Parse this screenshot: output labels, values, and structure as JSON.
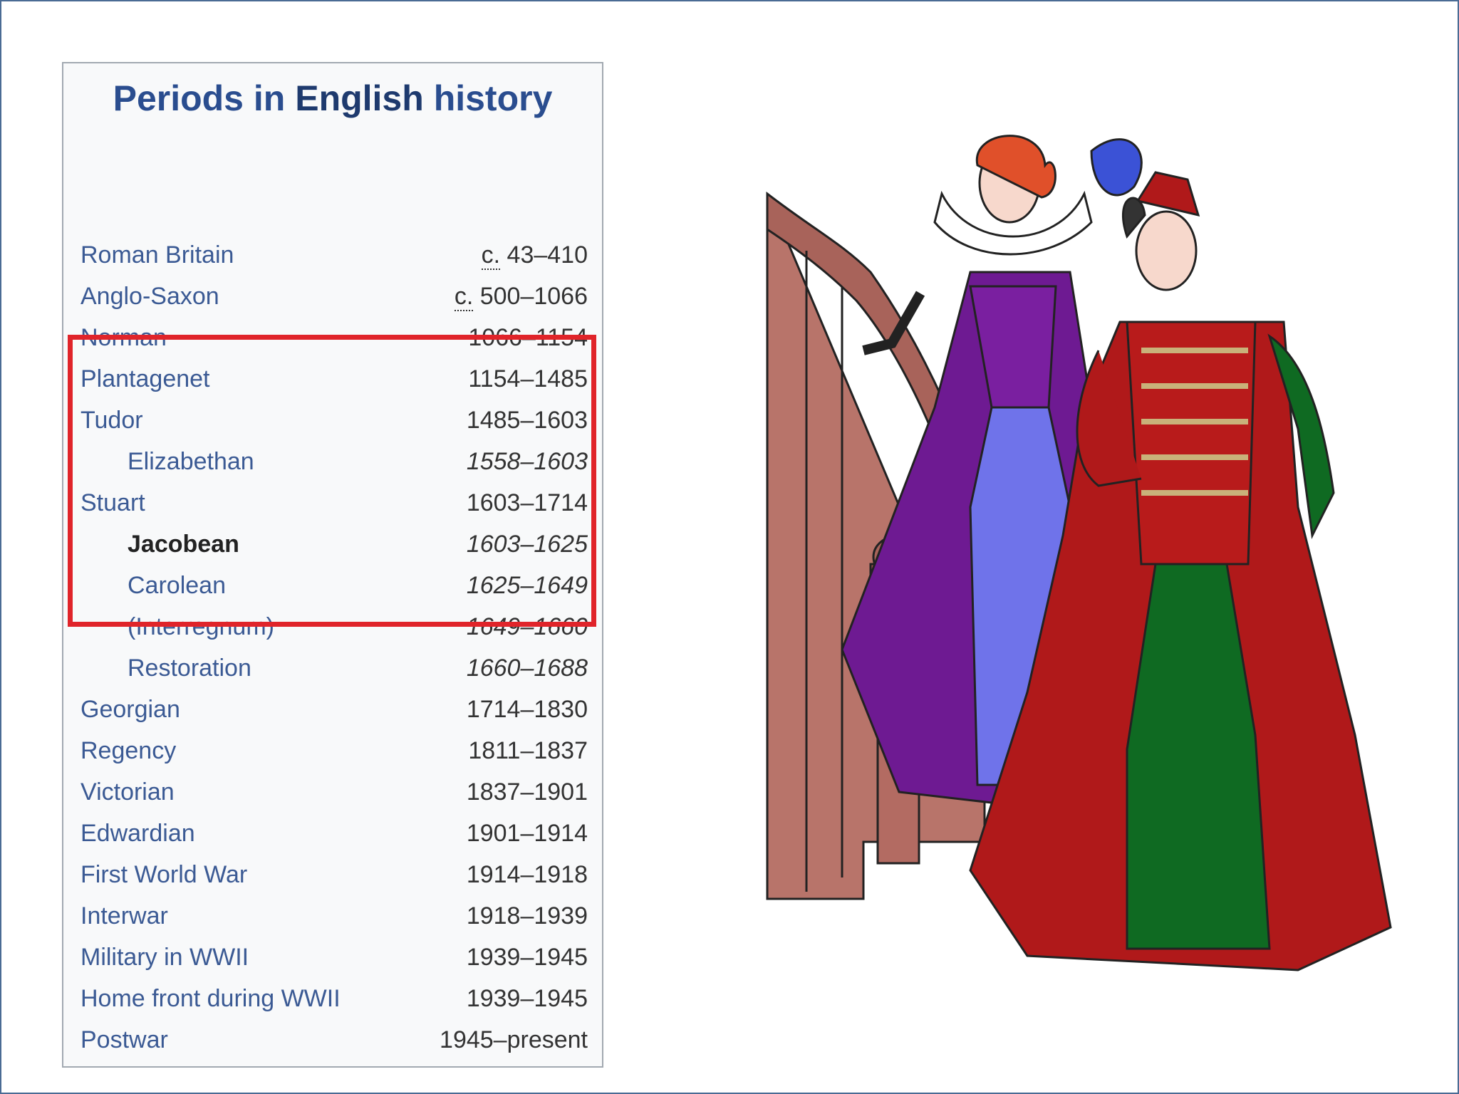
{
  "infobox": {
    "title_part1": "Periods in ",
    "title_part2": "English",
    "title_part3": " history",
    "periods": [
      {
        "name": "Roman Britain",
        "prefix": "c.",
        "years": " 43–410"
      },
      {
        "name": "Anglo-Saxon",
        "prefix": "c.",
        "years": " 500–1066"
      },
      {
        "name": "Norman",
        "years": "1066–1154"
      },
      {
        "name": "Plantagenet",
        "years": "1154–1485"
      },
      {
        "name": "Tudor",
        "years": "1485–1603"
      },
      {
        "name": "Elizabethan",
        "years": "1558–1603"
      },
      {
        "name": "Stuart",
        "years": "1603–1714"
      },
      {
        "name": "Jacobean",
        "years": "1603–1625"
      },
      {
        "name": "Carolean",
        "years": "1625–1649"
      },
      {
        "name": "(Interregnum)",
        "years": "1649–1660"
      },
      {
        "name": "Restoration",
        "years": "1660–1688"
      },
      {
        "name": "Georgian",
        "years": "1714–1830"
      },
      {
        "name": "Regency",
        "years": "1811–1837"
      },
      {
        "name": "Victorian",
        "years": "1837–1901"
      },
      {
        "name": "Edwardian",
        "years": "1901–1914"
      },
      {
        "name": "First World War",
        "years": "1914–1918"
      },
      {
        "name": "Interwar",
        "years": "1918–1939"
      },
      {
        "name": "Military in WWII",
        "years": "1939–1945"
      },
      {
        "name": "Home front during WWII",
        "years": "1939–1945"
      },
      {
        "name": "Postwar",
        "years": "1945–present"
      }
    ]
  },
  "colors": {
    "highlight_border": "#e0242a",
    "title_blue": "#2a4d8f",
    "link_blue": "#3b5a94",
    "slide_border": "#4a6b94"
  },
  "illustration": {
    "icon": "elizabethan-costumes-illustration"
  }
}
